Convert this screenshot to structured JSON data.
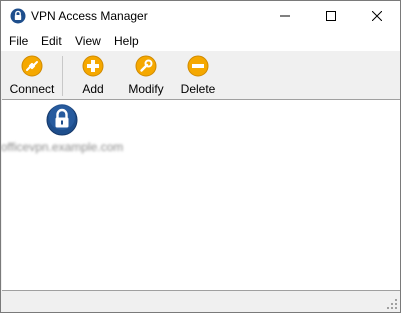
{
  "window": {
    "title": "VPN Access Manager"
  },
  "menu": [
    "File",
    "Edit",
    "View",
    "Help"
  ],
  "toolbar": {
    "connect": "Connect",
    "add": "Add",
    "modify": "Modify",
    "delete": "Delete"
  },
  "connections": [
    {
      "name": "officevpn.example.com",
      "icon": "lock-icon"
    }
  ],
  "colors": {
    "accent_orange": "#f5a800",
    "lock_blue": "#1e4e8c"
  }
}
